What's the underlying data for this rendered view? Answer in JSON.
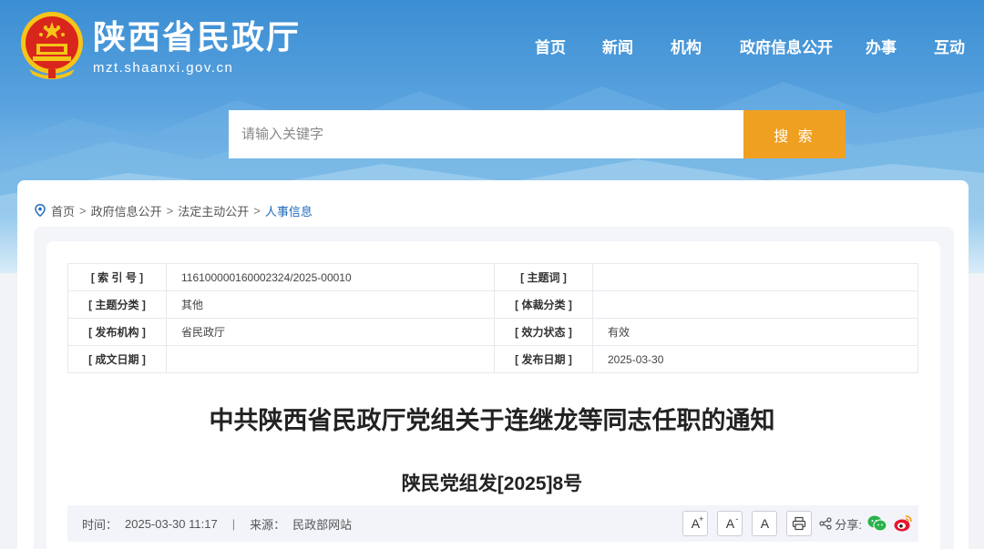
{
  "header": {
    "site_name": "陕西省民政厅",
    "site_url": "mzt.shaanxi.gov.cn",
    "nav": [
      "首页",
      "新闻",
      "机构",
      "政府信息公开",
      "办事",
      "互动"
    ]
  },
  "search": {
    "placeholder": "请输入关键字",
    "button_label": "搜 索"
  },
  "breadcrumb": [
    "首页",
    "政府信息公开",
    "法定主动公开",
    "人事信息"
  ],
  "meta": {
    "index_label": "[ 索 引 号 ]",
    "index_value": "116100000160002324/2025-00010",
    "keyword_label": "[ 主题词 ]",
    "keyword_value": "",
    "topic_label": "[ 主题分类 ]",
    "topic_value": "其他",
    "genre_label": "[ 体裁分类 ]",
    "genre_value": "",
    "issuer_label": "[ 发布机构 ]",
    "issuer_value": "省民政厅",
    "status_label": "[ 效力状态 ]",
    "status_value": "有效",
    "written_label": "[ 成文日期 ]",
    "written_value": "",
    "published_label": "[ 发布日期 ]",
    "published_value": "2025-03-30"
  },
  "document": {
    "title": "中共陕西省民政厅党组关于连继龙等同志任职的通知",
    "number": "陕民党组发[2025]8号"
  },
  "info_bar": {
    "time_label": "时间：",
    "time_value": "2025-03-30 11:17",
    "divider": "|",
    "source_label": "来源：",
    "source_value": "民政部网站",
    "font_large": "A",
    "font_small": "A",
    "font_normal": "A",
    "share_label": "分享:"
  },
  "colors": {
    "accent_orange": "#f0a020",
    "link_blue": "#1f6bbd",
    "banner_blue": "#3b8ed3"
  }
}
